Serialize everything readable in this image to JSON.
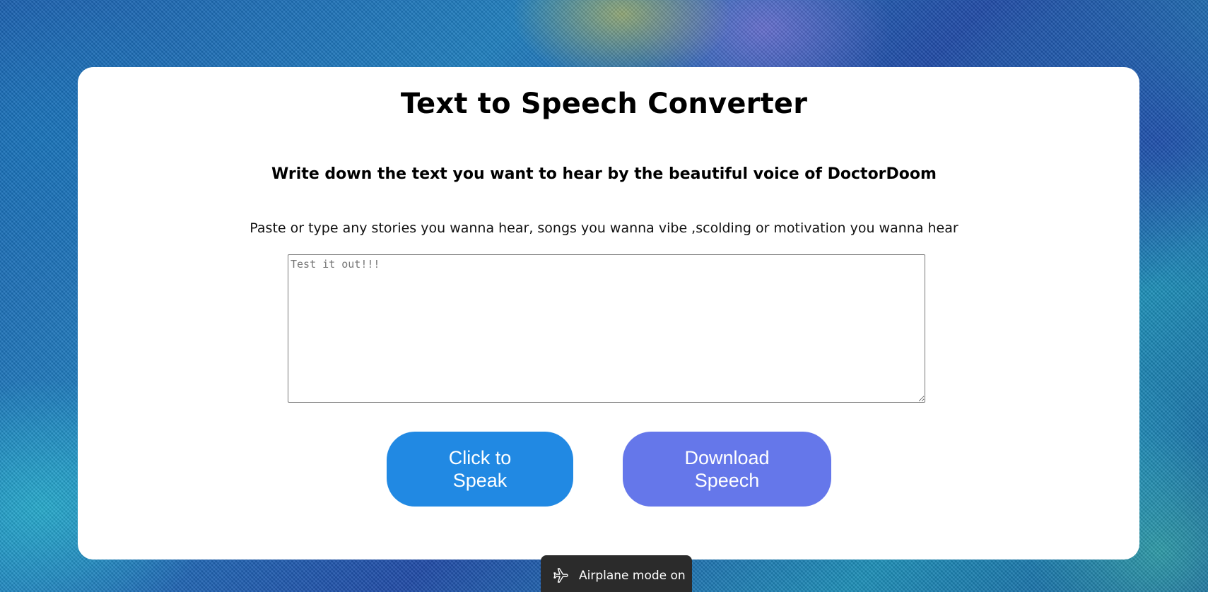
{
  "page": {
    "title": "Text to Speech Converter",
    "subtitle": "Write down the text you want to hear by the beautiful voice of DoctorDoom",
    "hint": "Paste or type any stories you wanna hear, songs you wanna vibe ,scolding or motivation you wanna hear"
  },
  "input": {
    "placeholder": "Test it out!!!",
    "value": ""
  },
  "buttons": {
    "speak": {
      "line1": "Click to",
      "line2": "Speak",
      "color": "#2189e3"
    },
    "download": {
      "line1": "Download",
      "line2": "Speech",
      "color": "#6577ea"
    }
  },
  "toast": {
    "icon": "airplane-icon",
    "text": "Airplane mode on"
  }
}
